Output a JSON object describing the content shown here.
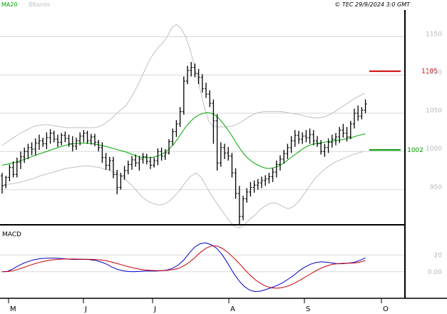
{
  "header": {
    "legend": [
      {
        "label": "MA20",
        "color": "#00aa00"
      },
      {
        "label": "BBands",
        "color": "#c0c0c0"
      }
    ],
    "copyright": "© TEC 29/9/2024 3:0 GMT"
  },
  "colors": {
    "price_bars": "#000000",
    "ma20": "#00aa00",
    "bbands": "#c0c0c0",
    "macd_line": "#0000cc",
    "macd_signal": "#cc0000",
    "resistance": "#cc0000",
    "support": "#009900",
    "grid": "#d8d8d8"
  },
  "chart_data": [
    {
      "type": "ohlc",
      "ylim": [
        905,
        1185
      ],
      "y_ticks": [
        950,
        1000,
        1050,
        1100,
        1150
      ],
      "x_labels": [
        "M",
        "J",
        "J",
        "A",
        "S",
        "O"
      ],
      "horizontal_levels": [
        {
          "value": 1105,
          "label": "1105",
          "color": "#cc0000"
        },
        {
          "value": 1002,
          "label": "1002",
          "color": "#009900"
        }
      ],
      "series": [
        {
          "name": "Price",
          "ohlc": [
            [
              968,
              972,
              945,
              955
            ],
            [
              956,
              968,
              952,
              966
            ],
            [
              966,
              983,
              961,
              979
            ],
            [
              979,
              987,
              966,
              970
            ],
            [
              970,
              992,
              966,
              986
            ],
            [
              986,
              1000,
              977,
              993
            ],
            [
              993,
              1005,
              985,
              1000
            ],
            [
              1000,
              1010,
              990,
              1005
            ],
            [
              1005,
              1012,
              995,
              1003
            ],
            [
              1003,
              1017,
              995,
              1011
            ],
            [
              1011,
              1022,
              1002,
              1014
            ],
            [
              1014,
              1018,
              1006,
              1010
            ],
            [
              1010,
              1025,
              1003,
              1018
            ],
            [
              1018,
              1029,
              1010,
              1024
            ],
            [
              1024,
              1027,
              1012,
              1016
            ],
            [
              1016,
              1022,
              1006,
              1012
            ],
            [
              1012,
              1024,
              1008,
              1021
            ],
            [
              1021,
              1026,
              1012,
              1017
            ],
            [
              1017,
              1022,
              1006,
              1010
            ],
            [
              1010,
              1020,
              1000,
              1007
            ],
            [
              1007,
              1018,
              1002,
              1014
            ],
            [
              1014,
              1025,
              1008,
              1020
            ],
            [
              1020,
              1028,
              1012,
              1024
            ],
            [
              1024,
              1027,
              1010,
              1014
            ],
            [
              1014,
              1023,
              1009,
              1019
            ],
            [
              1019,
              1023,
              1007,
              1012
            ],
            [
              1012,
              1015,
              1000,
              1005
            ],
            [
              1005,
              1012,
              985,
              992
            ],
            [
              992,
              998,
              976,
              982
            ],
            [
              982,
              993,
              975,
              988
            ],
            [
              988,
              993,
              965,
              970
            ],
            [
              970,
              976,
              944,
              953
            ],
            [
              953,
              972,
              950,
              968
            ],
            [
              968,
              981,
              963,
              975
            ],
            [
              975,
              988,
              970,
              983
            ],
            [
              983,
              994,
              976,
              989
            ],
            [
              989,
              996,
              980,
              985
            ],
            [
              985,
              994,
              975,
              990
            ],
            [
              990,
              998,
              984,
              993
            ],
            [
              993,
              997,
              983,
              987
            ],
            [
              987,
              993,
              977,
              982
            ],
            [
              982,
              992,
              979,
              988
            ],
            [
              988,
              1004,
              982,
              1000
            ],
            [
              1000,
              1005,
              988,
              994
            ],
            [
              994,
              1003,
              989,
              998
            ],
            [
              998,
              1016,
              996,
              1013
            ],
            [
              1013,
              1030,
              1008,
              1026
            ],
            [
              1026,
              1041,
              1019,
              1036
            ],
            [
              1036,
              1058,
              1032,
              1052
            ],
            [
              1052,
              1098,
              1048,
              1092
            ],
            [
              1092,
              1112,
              1088,
              1106
            ],
            [
              1106,
              1117,
              1098,
              1110
            ],
            [
              1110,
              1115,
              1097,
              1102
            ],
            [
              1102,
              1108,
              1088,
              1097
            ],
            [
              1097,
              1101,
              1077,
              1082
            ],
            [
              1082,
              1090,
              1070,
              1075
            ],
            [
              1075,
              1080,
              1058,
              1063
            ],
            [
              1063,
              1068,
              1010,
              1040
            ],
            [
              1040,
              1049,
              975,
              985
            ],
            [
              985,
              1012,
              980,
              1005
            ],
            [
              1005,
              1010,
              990,
              998
            ],
            [
              998,
              1006,
              988,
              994
            ],
            [
              994,
              998,
              966,
              972
            ],
            [
              972,
              978,
              938,
              945
            ],
            [
              945,
              955,
              903,
              915
            ],
            [
              915,
              942,
              910,
              938
            ],
            [
              938,
              952,
              933,
              947
            ],
            [
              947,
              960,
              941,
              953
            ],
            [
              953,
              962,
              946,
              956
            ],
            [
              956,
              964,
              950,
              959
            ],
            [
              959,
              967,
              952,
              962
            ],
            [
              962,
              969,
              955,
              964
            ],
            [
              964,
              972,
              958,
              967
            ],
            [
              967,
              978,
              960,
              973
            ],
            [
              973,
              988,
              966,
              983
            ],
            [
              983,
              995,
              975,
              990
            ],
            [
              990,
              1002,
              984,
              997
            ],
            [
              997,
              1010,
              990,
              1005
            ],
            [
              1005,
              1020,
              998,
              1014
            ],
            [
              1014,
              1028,
              1006,
              1021
            ],
            [
              1021,
              1027,
              1010,
              1016
            ],
            [
              1016,
              1025,
              1010,
              1020
            ],
            [
              1020,
              1028,
              1012,
              1018
            ],
            [
              1018,
              1030,
              1010,
              1022
            ],
            [
              1022,
              1028,
              1008,
              1014
            ],
            [
              1014,
              1020,
              1006,
              1010
            ],
            [
              1010,
              1015,
              996,
              1000
            ],
            [
              1000,
              1010,
              993,
              1005
            ],
            [
              1005,
              1017,
              998,
              1012
            ],
            [
              1012,
              1022,
              1005,
              1016
            ],
            [
              1016,
              1024,
              1008,
              1019
            ],
            [
              1019,
              1032,
              1011,
              1028
            ],
            [
              1028,
              1036,
              1018,
              1024
            ],
            [
              1024,
              1032,
              1013,
              1019
            ],
            [
              1019,
              1040,
              1016,
              1036
            ],
            [
              1036,
              1056,
              1030,
              1050
            ],
            [
              1050,
              1060,
              1040,
              1046
            ],
            [
              1046,
              1058,
              1042,
              1054
            ],
            [
              1054,
              1068,
              1050,
              1062
            ]
          ]
        },
        {
          "name": "MA20",
          "values": [
            982.0,
            983.1,
            984.3,
            985.7,
            987.3,
            989.0,
            991.0,
            993.0,
            995.0,
            996.9,
            998.8,
            1000.6,
            1002.5,
            1004.4,
            1006.3,
            1007.9,
            1009.1,
            1010.0,
            1010.6,
            1010.9,
            1010.9,
            1010.6,
            1009.8,
            1008.7,
            1007.6,
            1006.3,
            1004.8,
            1003.3,
            1001.7,
            1000.3,
            998.7,
            996.5,
            994.4,
            992.8,
            991.9,
            991.9,
            992.4,
            993.6,
            995.7,
            998.8,
            1003.1,
            1009.1,
            1016.3,
            1024.6,
            1032.3,
            1038.6,
            1043.8,
            1047.5,
            1049.7,
            1050.8,
            1050.2,
            1047.6,
            1042.7,
            1036.2,
            1028.8,
            1020.6,
            1011.8,
            1003.3,
            996.0,
            990.5,
            986.0,
            982.9,
            980.0,
            978.3,
            977.7,
            978.6,
            980.4,
            983.3,
            987.1,
            991.3,
            995.4,
            999.5,
            1003.4,
            1006.8,
            1008.8,
            1010.1,
            1011.0,
            1012.0,
            1012.8,
            1013.5,
            1014.2,
            1015.0,
            1016.0,
            1017.3,
            1018.8,
            1020.5,
            1021.8,
            1023.0
          ],
          "start_index": 10
        },
        {
          "name": "BBands",
          "upper": [
            1008,
            1012,
            1016,
            1020,
            1024,
            1027,
            1030,
            1033,
            1034,
            1035,
            1035,
            1034,
            1033,
            1032,
            1031,
            1031,
            1031,
            1031,
            1031,
            1031,
            1031,
            1032,
            1035,
            1039,
            1044,
            1050,
            1055,
            1060,
            1069,
            1080,
            1092,
            1105,
            1118,
            1128,
            1136,
            1142,
            1150,
            1162,
            1166,
            1161,
            1150,
            1133,
            1110,
            1085,
            1060,
            1040,
            1033,
            1032,
            1032,
            1032,
            1033,
            1035,
            1038,
            1042,
            1046,
            1049,
            1051,
            1052,
            1052,
            1052,
            1052,
            1052,
            1051,
            1050,
            1049,
            1048,
            1046,
            1045,
            1044,
            1044,
            1045,
            1047,
            1050,
            1054,
            1058,
            1062,
            1066,
            1070,
            1073,
            1076
          ],
          "lower": [
            956,
            957,
            958,
            959,
            961,
            963,
            965,
            968,
            970,
            972,
            974,
            976,
            978,
            979,
            980,
            981,
            981,
            980,
            979,
            977,
            975,
            972,
            968,
            962,
            956,
            948,
            940,
            935,
            932,
            930,
            931,
            935,
            942,
            950,
            960,
            968,
            972,
            965,
            952,
            940,
            930,
            920,
            910,
            902,
            900,
            905,
            912,
            918,
            925,
            930,
            933,
            932,
            928,
            925,
            928,
            935,
            945,
            955,
            965,
            972,
            978,
            983,
            987,
            990,
            993,
            996,
            998,
            1000
          ],
          "start_index": 18
        }
      ]
    },
    {
      "type": "line",
      "title": "MACD",
      "ylim": [
        -30,
        50
      ],
      "y_ticks": [
        0,
        20
      ],
      "y_tick_labels": [
        "0.00",
        "20"
      ],
      "series": [
        {
          "name": "MACD",
          "values": [
            0,
            0.5,
            3.5,
            7.3,
            10.4,
            12.7,
            14.6,
            15.6,
            16.0,
            16.2,
            16.1,
            15.6,
            15.0,
            14.7,
            14.7,
            14.8,
            14.3,
            13.4,
            11.6,
            9.0,
            5.4,
            2.7,
            1.1,
            0.2,
            0.0,
            0.4,
            0.8,
            0.9,
            0.8,
            1.2,
            2.1,
            4.2,
            8.0,
            13.9,
            22.2,
            29.5,
            33.5,
            34.3,
            32.1,
            27.8,
            20.1,
            9.8,
            -1.2,
            -10.6,
            -17.7,
            -22.1,
            -23.7,
            -23.1,
            -21.1,
            -18.9,
            -16.2,
            -12.9,
            -8.7,
            -4.1,
            1.2,
            5.6,
            8.9,
            10.9,
            11.9,
            11.3,
            10.3,
            9.5,
            9.6,
            10.3,
            11.3,
            13.6,
            16.5
          ]
        },
        {
          "name": "Signal",
          "values": [
            0,
            0.2,
            1.2,
            3.0,
            5.3,
            7.6,
            9.7,
            11.5,
            13.0,
            14.1,
            14.7,
            15.1,
            15.2,
            15.2,
            15.0,
            14.9,
            14.8,
            14.6,
            14.0,
            13.0,
            11.4,
            9.6,
            7.7,
            5.8,
            4.2,
            3.0,
            2.2,
            1.6,
            1.3,
            1.3,
            1.6,
            2.4,
            4.0,
            6.9,
            11.2,
            16.7,
            22.9,
            28.0,
            30.8,
            30.6,
            27.9,
            23.0,
            17.0,
            10.3,
            3.1,
            -3.9,
            -9.7,
            -14.2,
            -17.5,
            -19.3,
            -19.7,
            -18.8,
            -16.9,
            -14.1,
            -10.6,
            -6.7,
            -2.8,
            1.1,
            4.4,
            7.0,
            8.8,
            9.6,
            10.1,
            10.2,
            10.3,
            11.5,
            13.3
          ]
        }
      ]
    }
  ]
}
